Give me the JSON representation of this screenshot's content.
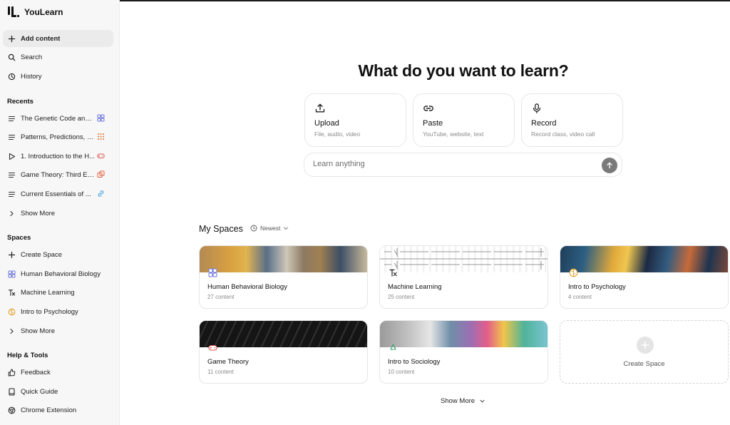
{
  "app": {
    "name": "YouLearn"
  },
  "nav": {
    "add_content": "Add content",
    "search": "Search",
    "history": "History"
  },
  "recents": {
    "title": "Recents",
    "items": [
      {
        "label": "The Genetic Code and ...",
        "badge": "ring-icon",
        "color": "#6b74d9"
      },
      {
        "label": "Patterns, Predictions, a...",
        "badge": "grid-icon",
        "color": "#e0722c"
      },
      {
        "label": "1. Introduction to the H...",
        "badge": "gamepad-icon",
        "color": "#d9534f"
      },
      {
        "label": "Game Theory: Third Edi...",
        "badge": "copy-icon",
        "color": "#e35d3a"
      },
      {
        "label": "Current Essentials of ...",
        "badge": "link-icon",
        "color": "#3aa0d9"
      }
    ],
    "show_more": "Show More"
  },
  "spaces_nav": {
    "title": "Spaces",
    "create": "Create Space",
    "items": [
      {
        "label": "Human Behavioral Biology"
      },
      {
        "label": "Machine Learning"
      },
      {
        "label": "Intro to Psychology"
      }
    ],
    "show_more": "Show More"
  },
  "help": {
    "title": "Help & Tools",
    "feedback": "Feedback",
    "guide": "Quick Guide",
    "extension": "Chrome Extension"
  },
  "main": {
    "headline": "What do you want to learn?",
    "actions": [
      {
        "title": "Upload",
        "subtitle": "File, audio, video"
      },
      {
        "title": "Paste",
        "subtitle": "YouTube, website, text"
      },
      {
        "title": "Record",
        "subtitle": "Record class, video call"
      }
    ],
    "input_placeholder": "Learn anything",
    "my_spaces": "My Spaces",
    "sort": "Newest",
    "spaces": [
      {
        "name": "Human Behavioral Biology",
        "count": "27 content"
      },
      {
        "name": "Machine Learning",
        "count": "25 content"
      },
      {
        "name": "Intro to Psychology",
        "count": "4 content"
      },
      {
        "name": "Game Theory",
        "count": "11 content"
      },
      {
        "name": "Intro to Sociology",
        "count": "10 content"
      }
    ],
    "create_space": "Create Space",
    "show_more": "Show More"
  }
}
